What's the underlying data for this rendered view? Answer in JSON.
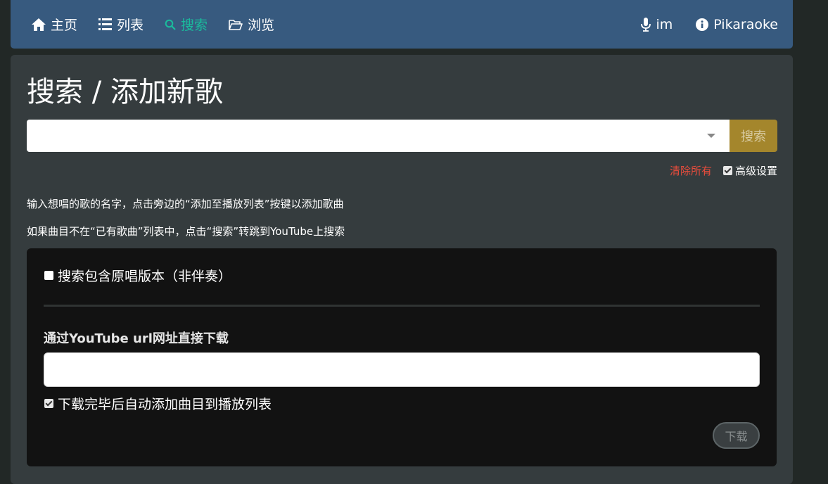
{
  "nav": {
    "items": [
      {
        "label": "主页",
        "icon": "home-icon",
        "active": false
      },
      {
        "label": "列表",
        "icon": "list-icon",
        "active": false
      },
      {
        "label": "搜索",
        "icon": "search-icon",
        "active": true
      },
      {
        "label": "浏览",
        "icon": "folder-open-icon",
        "active": false
      }
    ],
    "user_label": "im",
    "user_icon": "microphone-icon",
    "app_label": "Pikaraoke",
    "app_icon": "info-icon"
  },
  "page": {
    "title": "搜索 / 添加新歌",
    "search": {
      "value": "",
      "button_label": "搜索"
    },
    "clear_all_label": "清除所有",
    "advanced_label": "高级设置",
    "advanced_checked": true,
    "hint1": "输入想唱的歌的名字，点击旁边的“添加至播放列表”按键以添加歌曲",
    "hint2": "如果曲目不在“已有歌曲”列表中，点击“搜索”转跳到YouTube上搜索"
  },
  "advanced": {
    "include_original_label": "搜索包含原唱版本（非伴奏）",
    "include_original_checked": false,
    "download_label": "通过YouTube url网址直接下载",
    "url_value": "",
    "auto_add_label": "下载完毕后自动添加曲目到播放列表",
    "auto_add_checked": true,
    "download_button_label": "下载"
  },
  "colors": {
    "navbar": "#375a7f",
    "active": "#1abc9c",
    "search_button": "#a4862c",
    "danger": "#e74c3c",
    "background": "#222826",
    "card": "#353c3e",
    "panel": "#121212"
  }
}
